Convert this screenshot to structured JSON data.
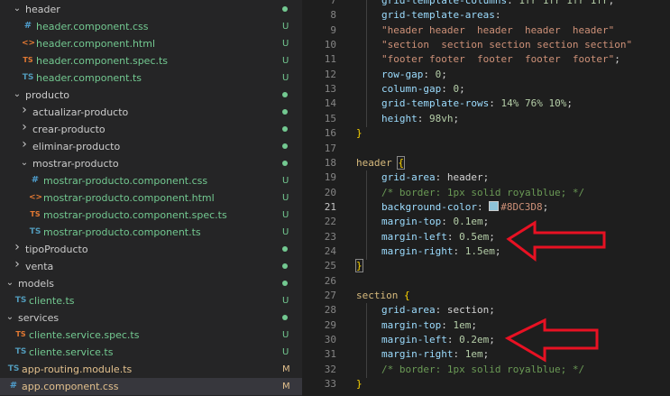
{
  "explorer": {
    "items": [
      {
        "type": "folder",
        "name": "header",
        "indent": 1,
        "open": true,
        "status": "dot"
      },
      {
        "type": "file",
        "name": "header.component.css",
        "indent": 2,
        "icon": "css",
        "git": "U"
      },
      {
        "type": "file",
        "name": "header.component.html",
        "indent": 2,
        "icon": "html",
        "git": "U"
      },
      {
        "type": "file",
        "name": "header.component.spec.ts",
        "indent": 2,
        "icon": "spec",
        "git": "U"
      },
      {
        "type": "file",
        "name": "header.component.ts",
        "indent": 2,
        "icon": "ts",
        "git": "U"
      },
      {
        "type": "folder",
        "name": "producto",
        "indent": 1,
        "open": true,
        "status": "dot"
      },
      {
        "type": "folder",
        "name": "actualizar-producto",
        "indent": 2,
        "open": false,
        "status": "dot"
      },
      {
        "type": "folder",
        "name": "crear-producto",
        "indent": 2,
        "open": false,
        "status": "dot"
      },
      {
        "type": "folder",
        "name": "eliminar-producto",
        "indent": 2,
        "open": false,
        "status": "dot"
      },
      {
        "type": "folder",
        "name": "mostrar-producto",
        "indent": 2,
        "open": true,
        "status": "dot"
      },
      {
        "type": "file",
        "name": "mostrar-producto.component.css",
        "indent": 3,
        "icon": "css",
        "git": "U"
      },
      {
        "type": "file",
        "name": "mostrar-producto.component.html",
        "indent": 3,
        "icon": "html",
        "git": "U"
      },
      {
        "type": "file",
        "name": "mostrar-producto.component.spec.ts",
        "indent": 3,
        "icon": "spec",
        "git": "U"
      },
      {
        "type": "file",
        "name": "mostrar-producto.component.ts",
        "indent": 3,
        "icon": "ts",
        "git": "U"
      },
      {
        "type": "folder",
        "name": "tipoProducto",
        "indent": 1,
        "open": false,
        "status": "dot"
      },
      {
        "type": "folder",
        "name": "venta",
        "indent": 1,
        "open": false,
        "status": "dot"
      },
      {
        "type": "folder",
        "name": "models",
        "indent": 0,
        "open": true,
        "status": "dot"
      },
      {
        "type": "file",
        "name": "cliente.ts",
        "indent": 1,
        "icon": "ts",
        "git": "U"
      },
      {
        "type": "folder",
        "name": "services",
        "indent": 0,
        "open": true,
        "status": "dot"
      },
      {
        "type": "file",
        "name": "cliente.service.spec.ts",
        "indent": 1,
        "icon": "spec",
        "git": "U"
      },
      {
        "type": "file",
        "name": "cliente.service.ts",
        "indent": 1,
        "icon": "ts",
        "git": "U"
      },
      {
        "type": "file",
        "name": "app-routing.module.ts",
        "indent": 0,
        "icon": "ts",
        "git": "M"
      },
      {
        "type": "file",
        "name": "app.component.css",
        "indent": 0,
        "icon": "css",
        "git": "M",
        "active": true
      }
    ]
  },
  "editor": {
    "current_line": 21,
    "lines": [
      {
        "n": 7,
        "tokens": [
          [
            "p",
            "grid-template-columns"
          ],
          [
            "t",
            ": "
          ],
          [
            "n",
            "1fr 1fr 1fr 1fr"
          ],
          [
            "t",
            ";"
          ]
        ]
      },
      {
        "n": 8,
        "tokens": [
          [
            "p",
            "grid-template-areas"
          ],
          [
            "t",
            ":"
          ]
        ]
      },
      {
        "n": 9,
        "tokens": [
          [
            "s",
            "\"header header  header  header  header\""
          ]
        ]
      },
      {
        "n": 10,
        "tokens": [
          [
            "s",
            "\"section  section section section section\""
          ]
        ]
      },
      {
        "n": 11,
        "tokens": [
          [
            "s",
            "\"footer footer  footer  footer  footer\""
          ],
          [
            "t",
            ";"
          ]
        ]
      },
      {
        "n": 12,
        "tokens": [
          [
            "p",
            "row-gap"
          ],
          [
            "t",
            ": "
          ],
          [
            "n",
            "0"
          ],
          [
            "t",
            ";"
          ]
        ]
      },
      {
        "n": 13,
        "tokens": [
          [
            "p",
            "column-gap"
          ],
          [
            "t",
            ": "
          ],
          [
            "n",
            "0"
          ],
          [
            "t",
            ";"
          ]
        ]
      },
      {
        "n": 14,
        "tokens": [
          [
            "p",
            "grid-template-rows"
          ],
          [
            "t",
            ": "
          ],
          [
            "n",
            "14% 76% 10%"
          ],
          [
            "t",
            ";"
          ]
        ]
      },
      {
        "n": 15,
        "tokens": [
          [
            "p",
            "height"
          ],
          [
            "t",
            ": "
          ],
          [
            "n",
            "98vh"
          ],
          [
            "t",
            ";"
          ]
        ]
      },
      {
        "n": 16,
        "tokens": [
          [
            "b",
            "}"
          ]
        ],
        "outer": true
      },
      {
        "n": 17,
        "tokens": [],
        "outer": true
      },
      {
        "n": 18,
        "tokens": [
          [
            "k",
            "header "
          ],
          [
            "b",
            "{"
          ]
        ],
        "outer": true
      },
      {
        "n": 19,
        "tokens": [
          [
            "p",
            "grid-area"
          ],
          [
            "t",
            ": header;"
          ]
        ]
      },
      {
        "n": 20,
        "tokens": [
          [
            "c",
            "/* border: 1px solid royalblue; */"
          ]
        ]
      },
      {
        "n": 21,
        "tokens": [
          [
            "p",
            "background-color"
          ],
          [
            "t",
            ": "
          ],
          [
            "sw",
            "#8DC3D8"
          ],
          [
            "s",
            "#8DC3D8"
          ],
          [
            "t",
            ";"
          ]
        ]
      },
      {
        "n": 22,
        "tokens": [
          [
            "p",
            "margin-top"
          ],
          [
            "t",
            ": "
          ],
          [
            "n",
            "0.1em"
          ],
          [
            "t",
            ";"
          ]
        ]
      },
      {
        "n": 23,
        "tokens": [
          [
            "p",
            "margin-left"
          ],
          [
            "t",
            ": "
          ],
          [
            "n",
            "0.5em"
          ],
          [
            "t",
            ";"
          ]
        ]
      },
      {
        "n": 24,
        "tokens": [
          [
            "p",
            "margin-right"
          ],
          [
            "t",
            ": "
          ],
          [
            "n",
            "1.5em"
          ],
          [
            "t",
            ";"
          ]
        ]
      },
      {
        "n": 25,
        "tokens": [
          [
            "b",
            "}"
          ]
        ],
        "outer": true
      },
      {
        "n": 26,
        "tokens": [],
        "outer": true
      },
      {
        "n": 27,
        "tokens": [
          [
            "k",
            "section "
          ],
          [
            "b",
            "{"
          ]
        ],
        "outer": true
      },
      {
        "n": 28,
        "tokens": [
          [
            "p",
            "grid-area"
          ],
          [
            "t",
            ": section;"
          ]
        ]
      },
      {
        "n": 29,
        "tokens": [
          [
            "p",
            "margin-top"
          ],
          [
            "t",
            ": "
          ],
          [
            "n",
            "1em"
          ],
          [
            "t",
            ";"
          ]
        ]
      },
      {
        "n": 30,
        "tokens": [
          [
            "p",
            "margin-left"
          ],
          [
            "t",
            ": "
          ],
          [
            "n",
            "0.2em"
          ],
          [
            "t",
            ";"
          ]
        ]
      },
      {
        "n": 31,
        "tokens": [
          [
            "p",
            "margin-right"
          ],
          [
            "t",
            ": "
          ],
          [
            "n",
            "1em"
          ],
          [
            "t",
            ";"
          ]
        ]
      },
      {
        "n": 32,
        "tokens": [
          [
            "c",
            "/* border: 1px solid royalblue; */"
          ]
        ]
      },
      {
        "n": 33,
        "tokens": [
          [
            "b",
            "}"
          ]
        ],
        "outer": true
      }
    ]
  },
  "annotations": {
    "arrow_color": "#e81123",
    "arrows": [
      "pointing-at-line-23",
      "pointing-at-line-30"
    ]
  },
  "colors": {
    "explorer_bg": "#252526",
    "editor_bg": "#1e1e1e",
    "git_untracked": "#73c991",
    "git_modified": "#e2c08d"
  }
}
